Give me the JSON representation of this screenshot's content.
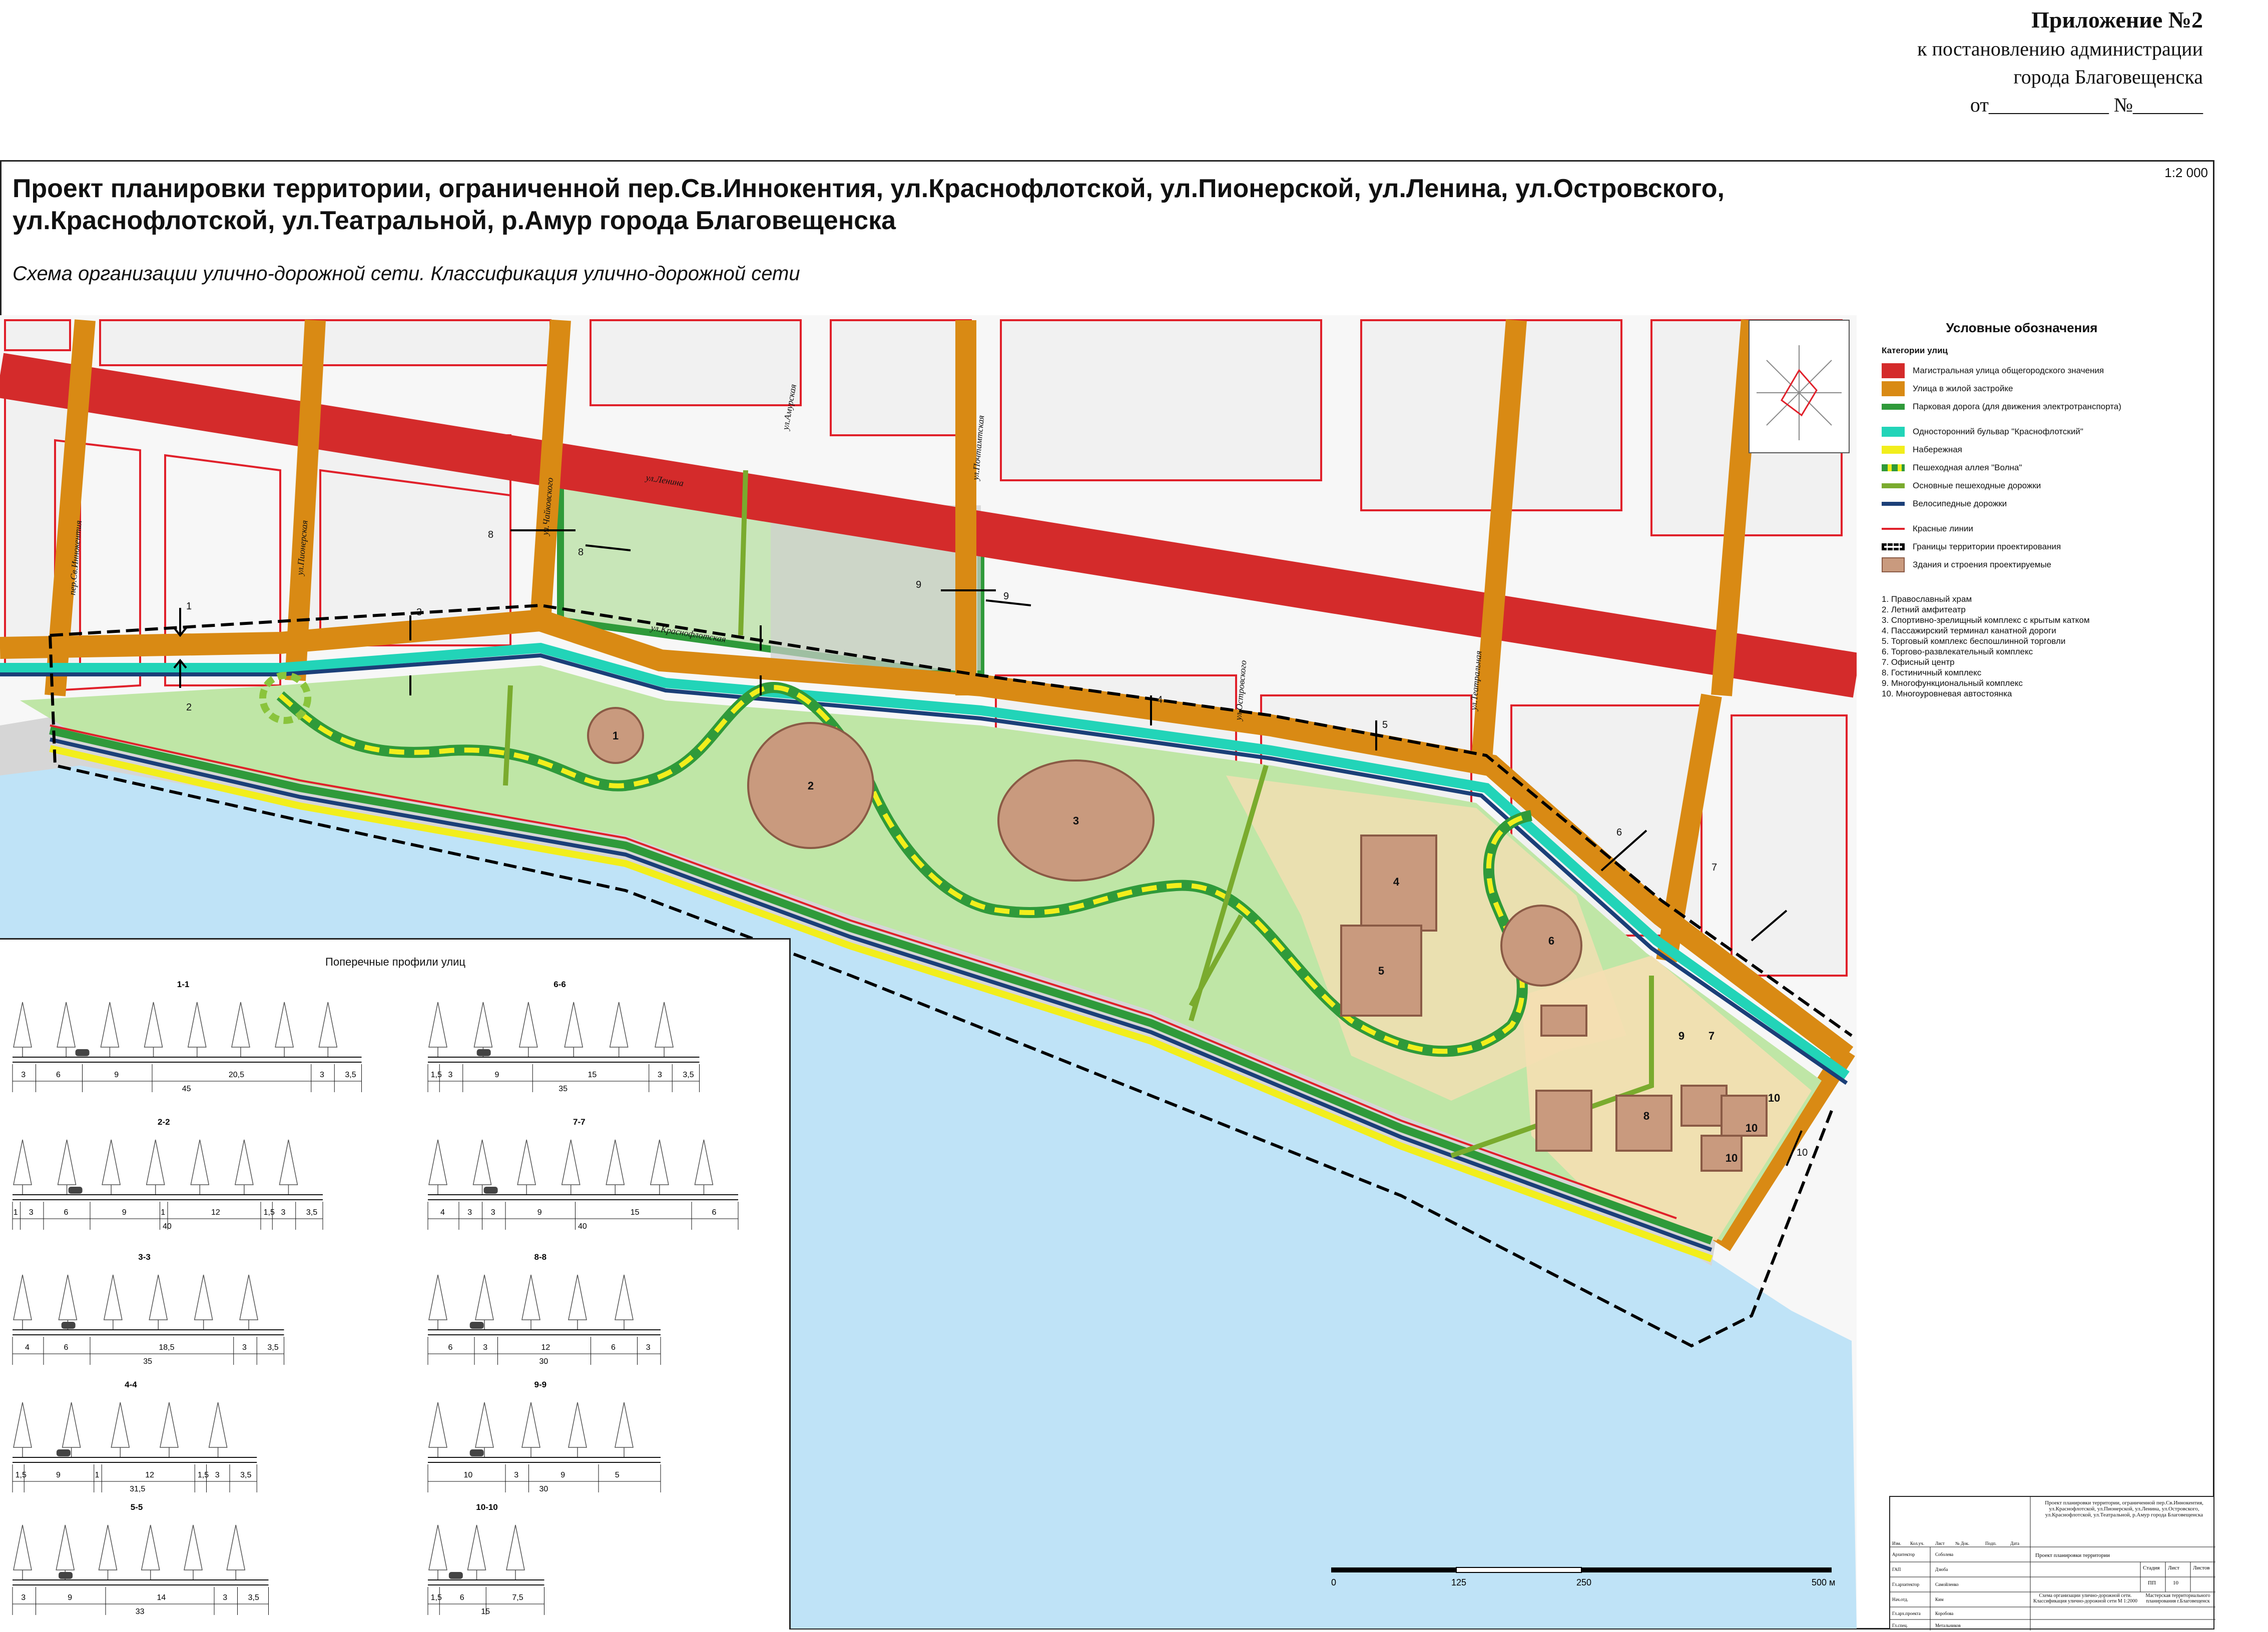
{
  "header": {
    "appendix": "Приложение №2",
    "line2": "к постановлению администрации",
    "line3": "города Благовещенска",
    "line4": "от____________ №_______"
  },
  "title": "Проект планировки территории, ограниченной пер.Св.Иннокентия, ул.Краснофлотской, ул.Пионерской, ул.Ленина, ул.Островского, ул.Краснофлотской, ул.Театральной, р.Амур города Благовещенска",
  "subtitle": "Схема организации улично-дорожной сети. Классификация улично-дорожной сети",
  "scale": "1:2 000",
  "colors": {
    "arterial": "#d42b2b",
    "residential": "#d98a14",
    "park_road": "#2f9a3a",
    "boulevard": "#22d4b8",
    "embankment": "#f2ee1c",
    "wave_alley": "#8ac43c",
    "ped_path": "#7aab2e",
    "bike": "#1b3f78",
    "red_line": "#e0202a",
    "building": "#c99a7e",
    "green_area": "#bfe6a6",
    "river": "#bfe3f7"
  },
  "legend": {
    "title": "Условные обозначения",
    "category_title": "Категории улиц",
    "items": [
      {
        "label": "Магистральная улица общегородского значения",
        "color": "#d42b2b"
      },
      {
        "label": "Улица в жилой застройке",
        "color": "#d98a14"
      },
      {
        "label": "Парковая дорога (для движения электротранспорта)",
        "color": "#2f9a3a"
      },
      {
        "label": "Односторонний бульвар \"Краснофлотский\"",
        "color": "#22d4b8"
      },
      {
        "label": "Набережная",
        "color": "#f2ee1c"
      },
      {
        "label": "Пешеходная аллея \"Волна\"",
        "color": "#8ac43c"
      },
      {
        "label": "Основные пешеходные дорожки",
        "color": "#7aab2e"
      },
      {
        "label": "Велосипедные дорожки",
        "color": "#1b3f78"
      },
      {
        "label": "Красные линии",
        "color": "#e0202a"
      },
      {
        "label": "Границы территории проектирования",
        "color": "#000000"
      },
      {
        "label": "Здания и строения проектируемые",
        "color": "#c99a7e"
      }
    ],
    "numbered": [
      "1. Православный храм",
      "2. Летний амфитеатр",
      "3. Спортивно-зрелищный комплекс с крытым катком",
      "4. Пассажирский терминал канатной дороги",
      "5. Торговый комплекс беспошлинной торговли",
      "6. Торгово-развлекательный комплекс",
      "7. Офисный центр",
      "8. Гостиничный комплекс",
      "9. Многофункциональный комплекс",
      "10. Многоуровневая автостоянка"
    ]
  },
  "streets": {
    "lenina": "ул.Ленина",
    "krasnoflot": "ул.Краснофлотская",
    "innokentiya": "пер.Св.Иннокентия",
    "pionerskaya": "ул.Пионерская",
    "teatralnaya": "ул.Театральная",
    "ostrovskogo": "ул.Островского",
    "amurskaya": "ул.Амурская",
    "chaykovskogo": "ул.Чайковского",
    "pochtamt": "ул.Почтамтская"
  },
  "map_labels": {
    "buildings": [
      "1",
      "2",
      "3",
      "4",
      "5",
      "6",
      "7",
      "8",
      "9",
      "10",
      "10",
      "10"
    ],
    "sections": [
      "1",
      "2",
      "3",
      "4",
      "5",
      "6",
      "7",
      "8",
      "8",
      "9",
      "9",
      "10"
    ]
  },
  "profiles": {
    "title": "Поперечные профили улиц",
    "items": [
      {
        "name": "1-1",
        "dims": [
          "3",
          "6",
          "9",
          "20,5",
          "3",
          "3,5"
        ],
        "total": "45"
      },
      {
        "name": "2-2",
        "dims": [
          "1",
          "3",
          "6",
          "9",
          "1",
          "12",
          "1,5",
          "3",
          "3,5"
        ],
        "total": "40"
      },
      {
        "name": "3-3",
        "dims": [
          "4",
          "6",
          "18,5",
          "3",
          "3,5"
        ],
        "total": "35"
      },
      {
        "name": "4-4",
        "dims": [
          "1,5",
          "9",
          "1",
          "12",
          "1,5",
          "3",
          "3,5"
        ],
        "total": "31,5"
      },
      {
        "name": "5-5",
        "dims": [
          "3",
          "9",
          "14",
          "3",
          "3,5"
        ],
        "total": "33"
      },
      {
        "name": "6-6",
        "dims": [
          "1,5",
          "3",
          "9",
          "15",
          "3",
          "3,5"
        ],
        "total": "35"
      },
      {
        "name": "7-7",
        "dims": [
          "4",
          "3",
          "3",
          "9",
          "15",
          "6"
        ],
        "total": "40"
      },
      {
        "name": "8-8",
        "dims": [
          "6",
          "3",
          "12",
          "6",
          "3"
        ],
        "total": "30"
      },
      {
        "name": "9-9",
        "dims": [
          "10",
          "3",
          "9",
          "5"
        ],
        "total": "30"
      },
      {
        "name": "10-10",
        "dims": [
          "1,5",
          "6",
          "7,5"
        ],
        "total": "15"
      }
    ]
  },
  "bar_scale": {
    "ticks": [
      "0",
      "125",
      "250",
      "500 м"
    ]
  },
  "stamp": {
    "project": "Проект планировки территории, ограниченной пер.Св.Иннокентия, ул.Краснофлотской, ул.Пионерской, ул.Ленина, ул.Островского, ул.Краснофлотской, ул.Театральной, р.Амур города Благовещенска",
    "doc_title": "Проект планировки территории",
    "sheet_title": "Схема организации улично-дорожной сети. Классификация улично-дорожной сети М 1:2000",
    "org": "Мастерская территориального планирования г.Благовещенск",
    "stage_label": "Стадия",
    "sheet_label": "Лист",
    "sheets_label": "Листов",
    "stage": "ПП",
    "sheet": "10",
    "rows": [
      "Архитектор",
      "ГАП",
      "Гл.архитектор",
      "Нач.отд.",
      "Гл.арх.проекта",
      "Гл.спец."
    ],
    "names": [
      "Соболева",
      "Дзюба",
      "Самойленко",
      "Ким",
      "Коробова",
      "Метальников"
    ],
    "cols": [
      "Изм.",
      "Кол.уч.",
      "Лист",
      "№ Док.",
      "Подп.",
      "Дата"
    ]
  }
}
